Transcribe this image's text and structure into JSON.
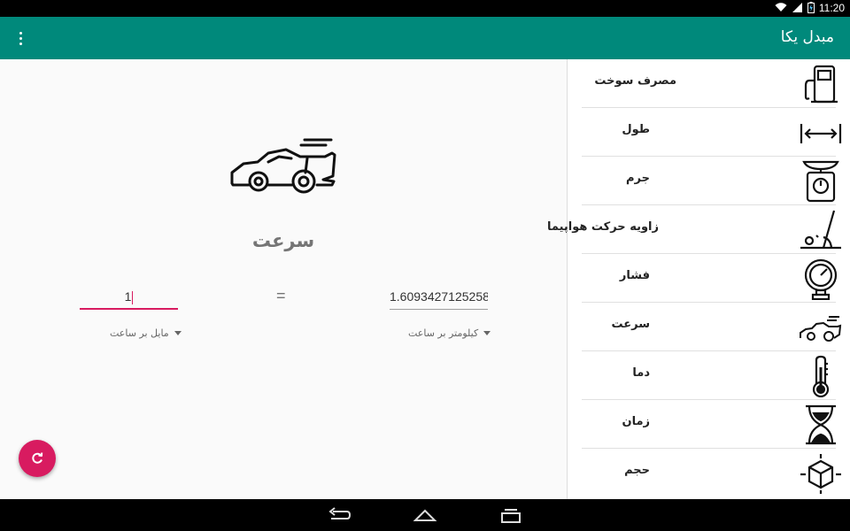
{
  "status_bar": {
    "time": "11:20",
    "icons": [
      "wifi-icon",
      "signal-icon",
      "battery-charging-icon"
    ]
  },
  "app_bar": {
    "title": "مبدل یکا",
    "menu_icon": "more-vert-icon"
  },
  "sidebar": {
    "items": [
      {
        "label": "مصرف سوخت",
        "icon": "fuel-pump-icon"
      },
      {
        "label": "طول",
        "icon": "length-arrow-icon"
      },
      {
        "label": "جرم",
        "icon": "scale-icon"
      },
      {
        "label": "زاویه حرکت هواپیما",
        "icon": "angle-icon"
      },
      {
        "label": "فشار",
        "icon": "pressure-gauge-icon"
      },
      {
        "label": "سرعت",
        "icon": "race-car-icon"
      },
      {
        "label": "دما",
        "icon": "thermometer-icon"
      },
      {
        "label": "زمان",
        "icon": "hourglass-icon"
      },
      {
        "label": "حجم",
        "icon": "volume-cube-icon"
      }
    ]
  },
  "main": {
    "unit_icon": "race-car-icon",
    "unit_title": "سرعت",
    "from_value": "1",
    "to_value": "1.6093427125258",
    "equals": "=",
    "from_unit": "مایل بر ساعت",
    "to_unit": "کیلومتر بر ساعت"
  },
  "fab": {
    "icon": "refresh-icon"
  },
  "nav_bar": {
    "icons": [
      "back-icon",
      "home-icon",
      "recents-icon"
    ]
  },
  "colors": {
    "primary": "#00897B",
    "accent": "#D81B60",
    "background": "#FAFAFA"
  }
}
